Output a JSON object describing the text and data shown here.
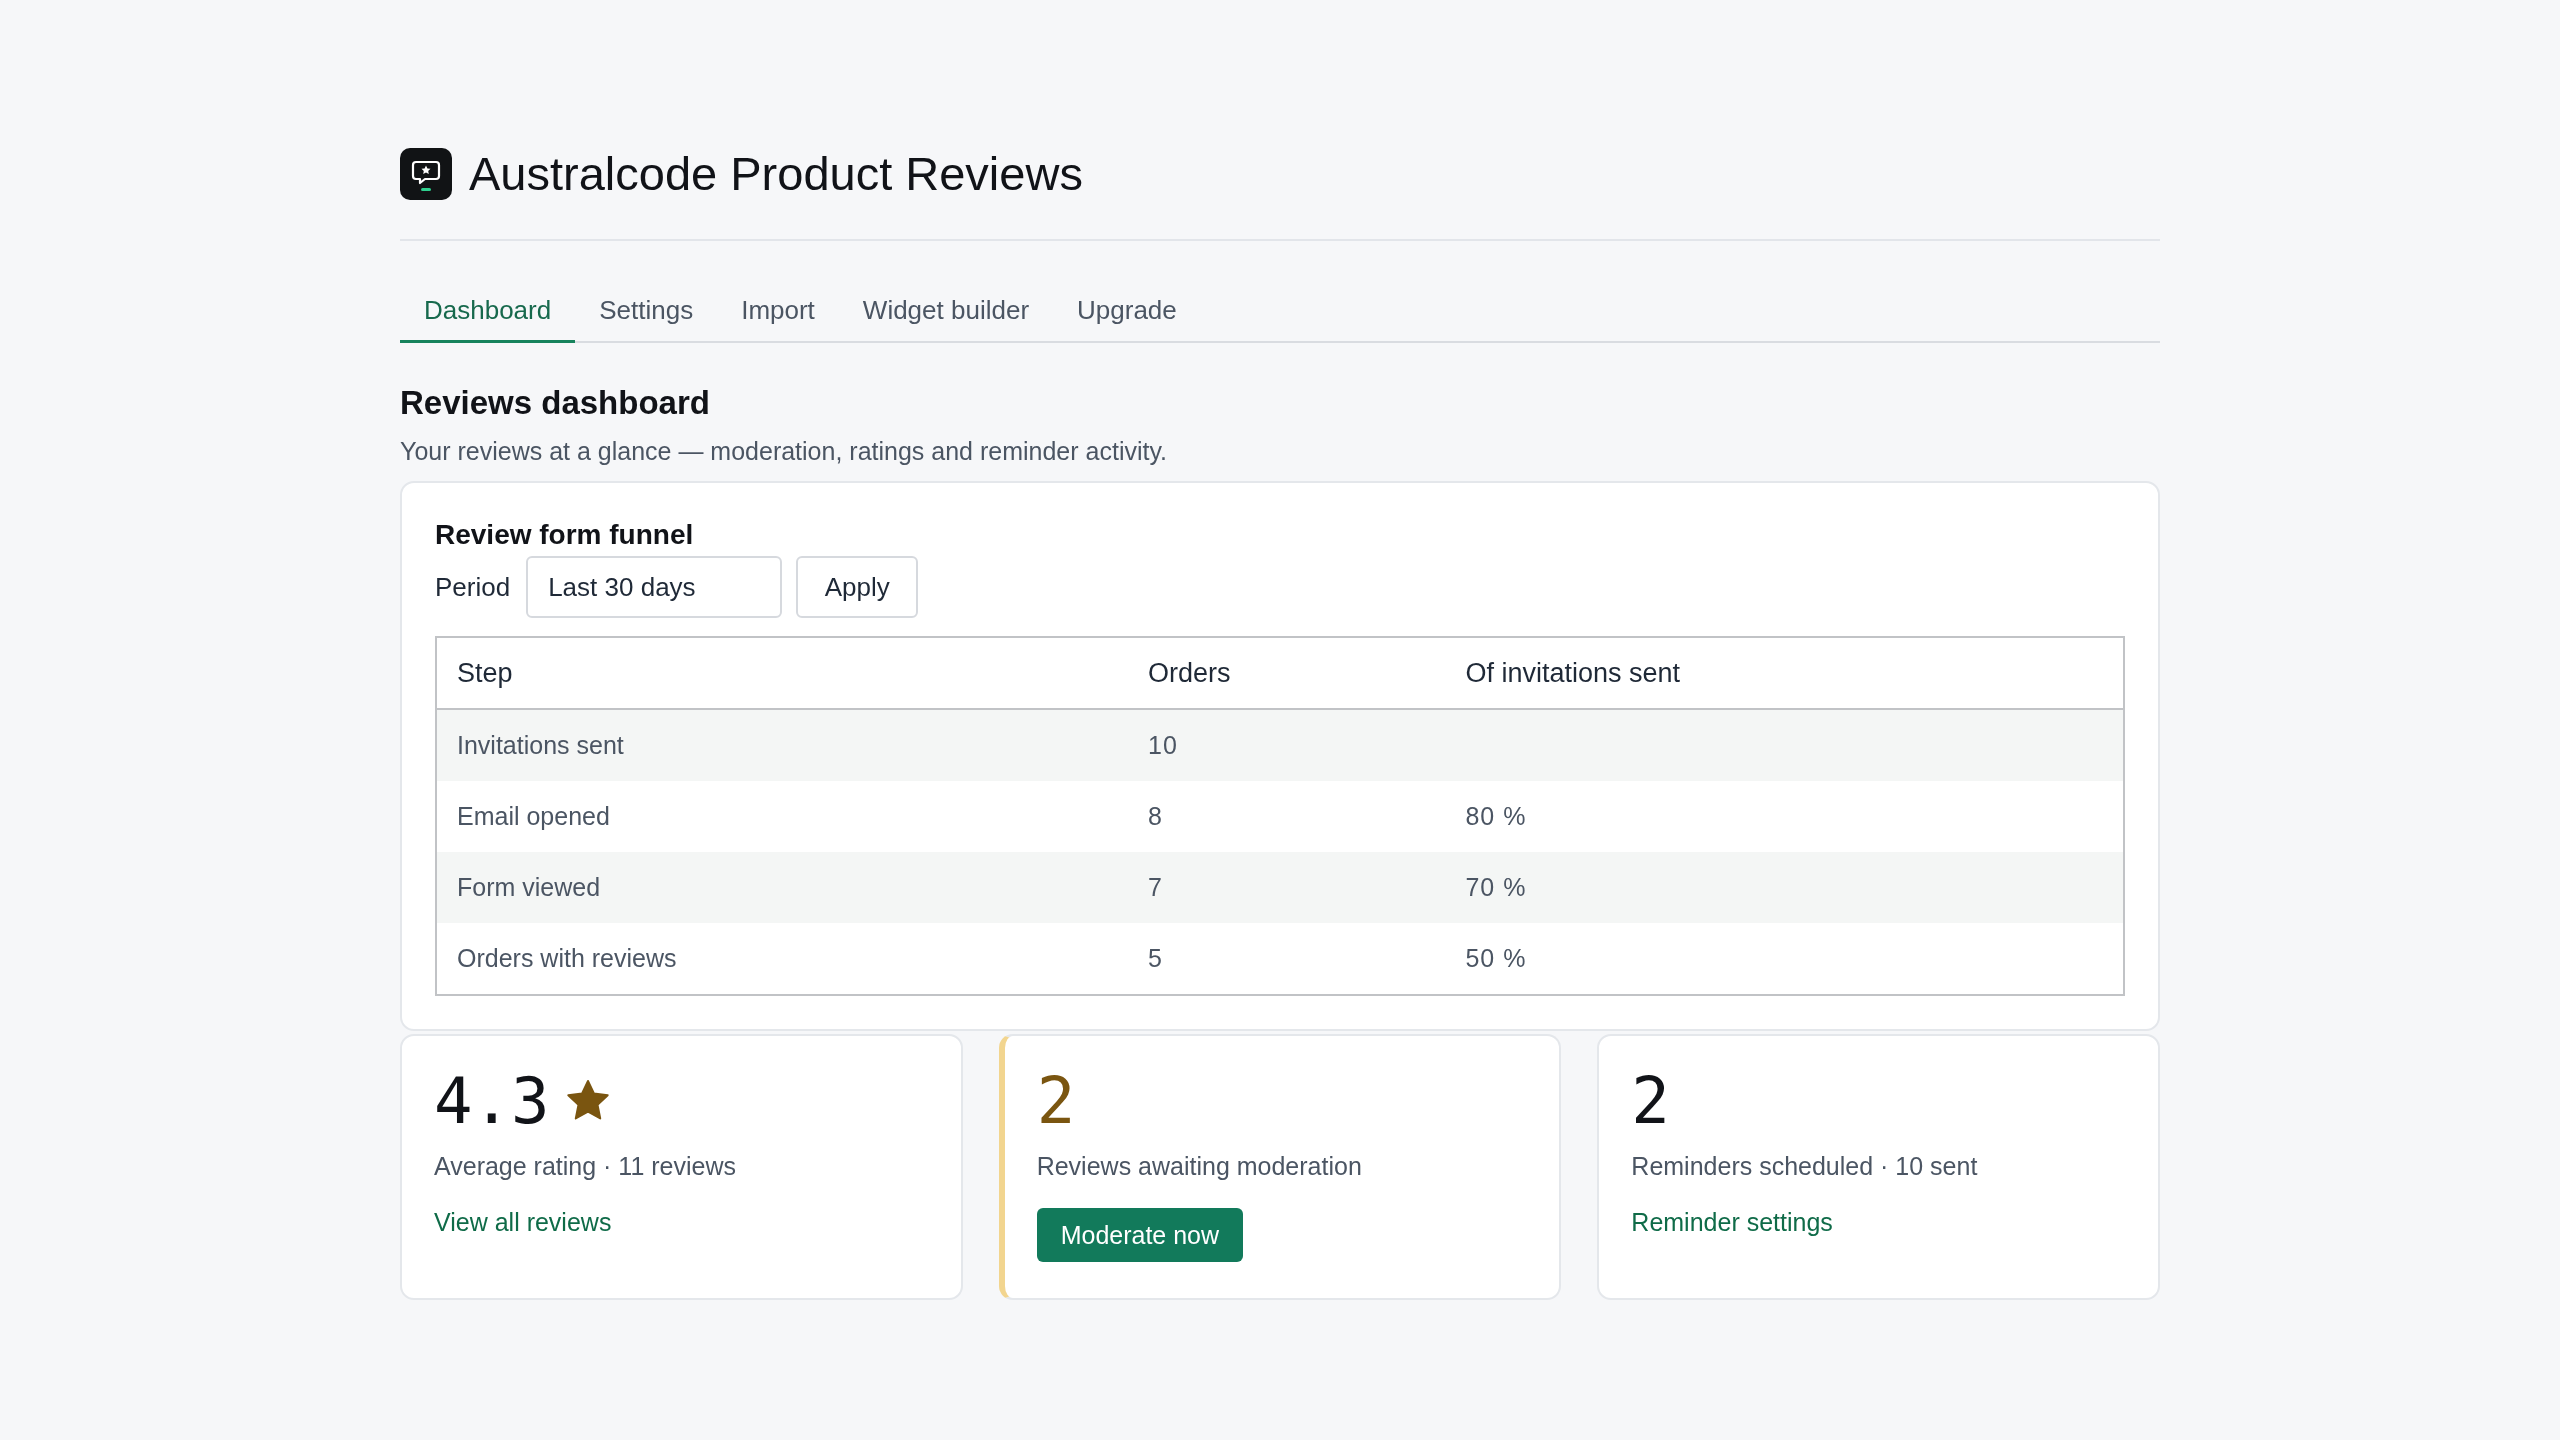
{
  "app": {
    "title": "Australcode Product Reviews"
  },
  "tabs": [
    {
      "label": "Dashboard",
      "selected": true
    },
    {
      "label": "Settings",
      "selected": false
    },
    {
      "label": "Import",
      "selected": false
    },
    {
      "label": "Widget builder",
      "selected": false
    },
    {
      "label": "Upgrade",
      "selected": false
    }
  ],
  "page": {
    "heading": "Reviews dashboard",
    "description": "Your reviews at a glance — moderation, ratings and reminder activity."
  },
  "funnel": {
    "title": "Review form funnel",
    "period": {
      "label": "Period",
      "value": "Last 30 days"
    },
    "apply_button": "Apply",
    "columns": [
      "Step",
      "Orders",
      "Of invitations sent"
    ],
    "rows": [
      {
        "step": "Invitations sent",
        "orders": "10"
      },
      {
        "step": "Email opened",
        "orders": "8",
        "share": "80 %"
      },
      {
        "step": "Form viewed",
        "orders": "7",
        "share": "70 %"
      },
      {
        "step": "Orders with reviews",
        "orders": "5",
        "share": "50 %"
      }
    ]
  },
  "stats": [
    {
      "kind": "rating",
      "value": "4.3",
      "caption": "Average rating · 11 reviews",
      "highlighted": false,
      "action": {
        "kind": "link",
        "label": "View all reviews"
      }
    },
    {
      "kind": "count",
      "value": "2",
      "caption": "Reviews awaiting moderation",
      "highlighted": true,
      "action": {
        "kind": "button",
        "label": "Moderate now"
      }
    },
    {
      "kind": "count",
      "value": "2",
      "caption": "Reminders scheduled · 10 sent",
      "highlighted": false,
      "action": {
        "kind": "link",
        "label": "Reminder settings"
      }
    }
  ]
}
